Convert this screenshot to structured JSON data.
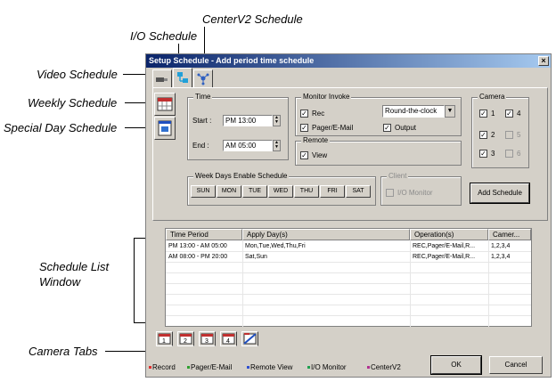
{
  "callouts": {
    "centerv2": "CenterV2 Schedule",
    "io": "I/O Schedule",
    "video": "Video Schedule",
    "weekly": "Weekly Schedule",
    "special": "Special Day Schedule",
    "schedule_list_1": "Schedule List",
    "schedule_list_2": "Window",
    "camera_tabs": "Camera Tabs"
  },
  "window": {
    "title": "Setup Schedule - Add period time schedule",
    "close_glyph": "×"
  },
  "time_group": {
    "label": "Time",
    "start_label": "Start :",
    "start_value": "PM 13:00",
    "end_label": "End :",
    "end_value": "AM 05:00"
  },
  "monitor_group": {
    "label": "Monitor Invoke",
    "rec": "Rec",
    "pager": "Pager/E-Mail",
    "output": "Output",
    "mode_select": "Round-the-clock"
  },
  "remote_group": {
    "label": "Remote",
    "view": "View"
  },
  "camera_group": {
    "label": "Camera",
    "c1": "1",
    "c2": "2",
    "c3": "3",
    "c4": "4",
    "c5": "5",
    "c6": "6"
  },
  "weekdays_group": {
    "label": "Week Days Enable Schedule",
    "days": [
      "SUN",
      "MON",
      "TUE",
      "WED",
      "THU",
      "FRI",
      "SAT"
    ]
  },
  "client_group": {
    "label": "Client",
    "io_monitor": "I/O Monitor"
  },
  "add_schedule_button": "Add Schedule",
  "list": {
    "columns": [
      "Time Period",
      "Apply Day(s)",
      "Operation(s)",
      "Camer..."
    ],
    "rows": [
      [
        "PM 13:00 - AM 05:00",
        "Mon,Tue,Wed,Thu,Fri",
        "REC,Pager/E-Mail,R...",
        "1,2,3,4"
      ],
      [
        "AM 08:00 - PM 20:00",
        "Sat,Sun",
        "REC,Pager/E-Mail,R...",
        "1,2,3,4"
      ]
    ]
  },
  "camera_tabs": [
    "1",
    "2",
    "3",
    "4"
  ],
  "legend": {
    "record": "Record",
    "pager": "Pager/E-Mail",
    "remote": "Remote View",
    "io": "I/O Monitor",
    "centerv2": "CenterV2"
  },
  "colors": {
    "record": "#e03030",
    "pager": "#30a030",
    "remote": "#3050d0",
    "io": "#20a050",
    "centerv2": "#b03090"
  },
  "ok_button": "OK",
  "cancel_button": "Cancel"
}
